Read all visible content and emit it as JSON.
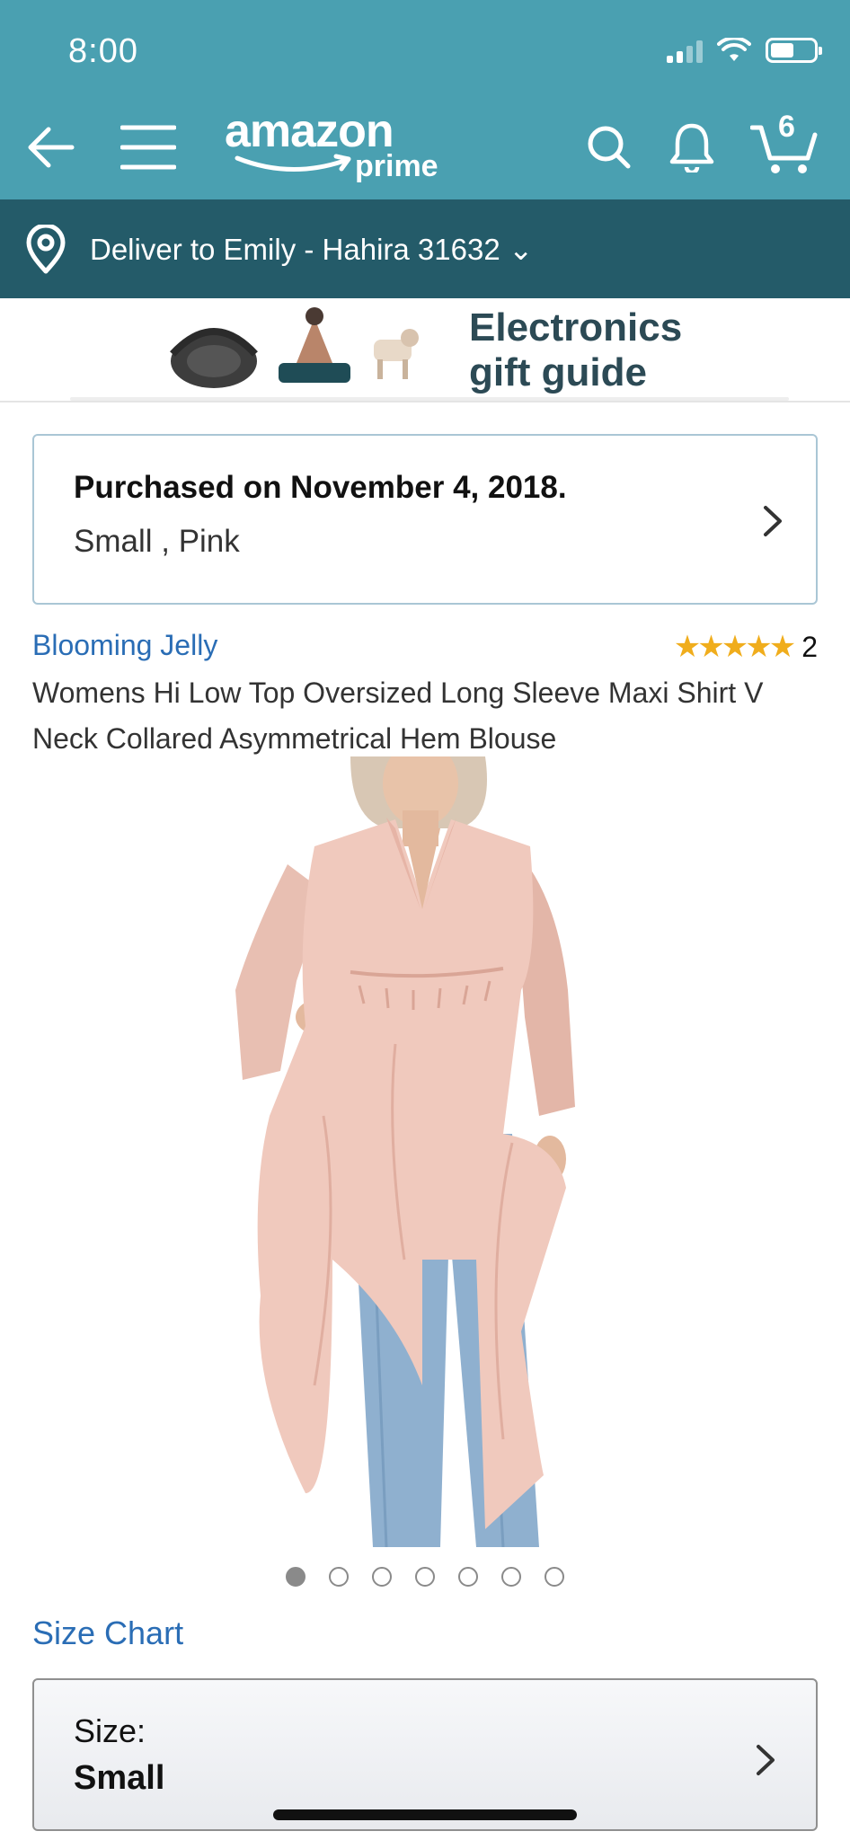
{
  "status_bar": {
    "time": "8:00",
    "battery_level": 0.55
  },
  "nav": {
    "logo_text": "amazon",
    "logo_sub": "prime",
    "cart_count": "6",
    "icons": [
      "back-arrow-icon",
      "menu-icon",
      "search-icon",
      "bell-icon",
      "cart-icon"
    ]
  },
  "deliver": {
    "label": "Deliver to Emily - Hahira 31632 ⌄"
  },
  "banner": {
    "line1": "Electronics",
    "line2": "gift guide"
  },
  "purchase": {
    "title": "Purchased on November 4, 2018.",
    "variant": "Small , Pink"
  },
  "product": {
    "brand": "Blooming Jelly",
    "stars": "★★★★★",
    "rating_count": "2",
    "title": "Womens Hi Low Top Oversized Long Sleeve Maxi Shirt V Neck Collared Asymmetrical Hem Blouse",
    "image_count": 7,
    "active_image": 1
  },
  "size": {
    "chart_link": "Size Chart",
    "label": "Size:",
    "value": "Small"
  },
  "colors": {
    "topbar": "#4aa0b1",
    "deliver_bar": "#245b69",
    "link": "#2a6db5",
    "star": "#f0ad1c"
  }
}
